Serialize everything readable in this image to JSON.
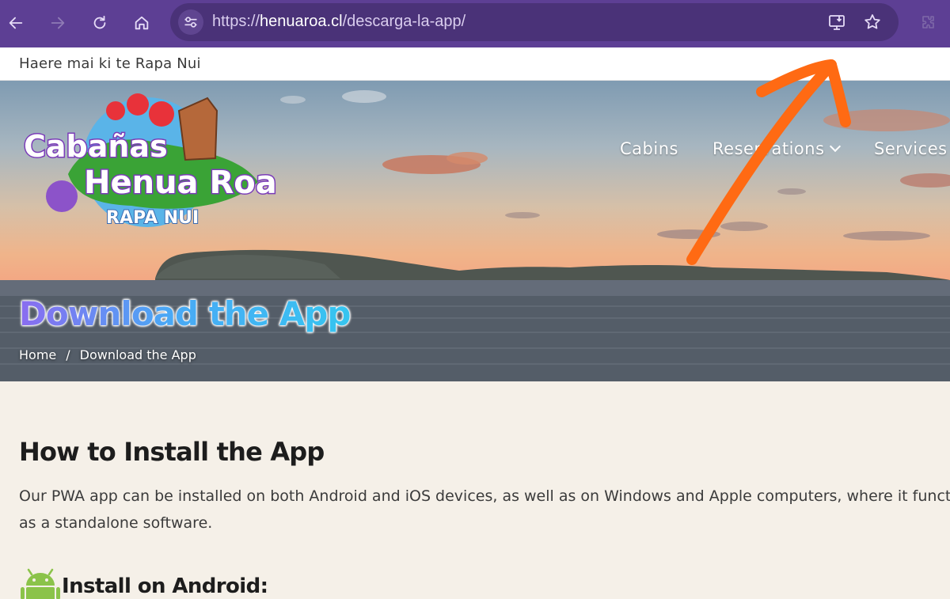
{
  "browser": {
    "url_prefix": "https://",
    "url_host": "henuaroa.cl",
    "url_path": "/descarga-la-app/",
    "back_icon": "arrow-left-icon",
    "forward_icon": "arrow-right-icon",
    "reload_icon": "reload-icon",
    "home_icon": "home-icon",
    "site_info_icon": "tune-icon",
    "install_icon": "install-app-icon",
    "bookmark_icon": "star-icon",
    "extensions_icon": "puzzle-icon",
    "theme_color": "#5d3f94"
  },
  "topbar": {
    "greeting": "Haere mai ki te Rapa Nui"
  },
  "logo": {
    "line1": "Cabañas",
    "line2": "Henua Roa",
    "line3": "RAPA NUI"
  },
  "nav": {
    "items": [
      {
        "label": "Cabins"
      },
      {
        "label": "Reservations",
        "has_dropdown": true
      },
      {
        "label": "Services"
      }
    ]
  },
  "hero": {
    "title": "Download the App",
    "breadcrumb": {
      "home": "Home",
      "separator": "/",
      "current": "Download the App"
    }
  },
  "content": {
    "heading": "How to Install the App",
    "paragraph_line1": "Our PWA app can be installed on both Android and iOS devices, as well as on Windows and Apple computers, where it functions",
    "paragraph_line2": "as a standalone software.",
    "android_heading": "Install on Android:",
    "android_icon": "android-icon"
  },
  "annotation": {
    "arrow_color": "#ff6a13"
  }
}
